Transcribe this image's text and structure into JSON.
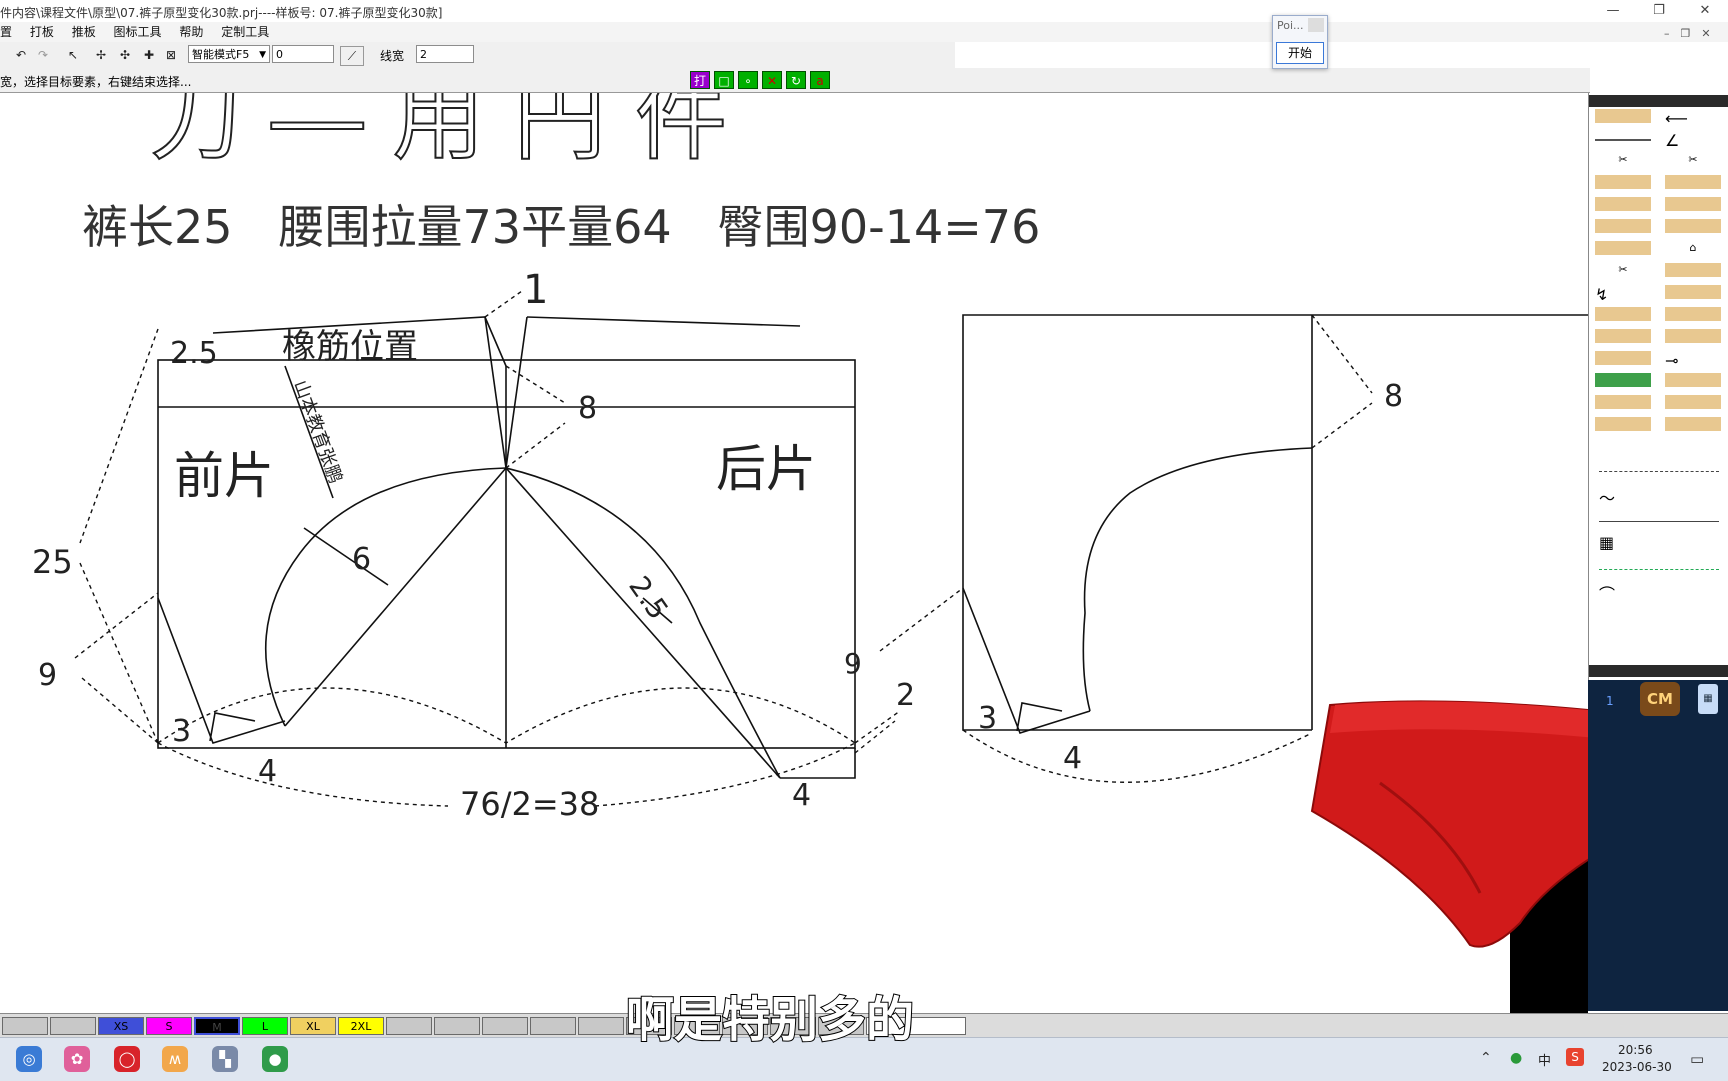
{
  "window": {
    "title": "件内容\\课程文件\\原型\\07.裤子原型变化30款.prj----样板号: 07.裤子原型变化30款]"
  },
  "menu": [
    "置",
    "打板",
    "推板",
    "图标工具",
    "帮助",
    "定制工具"
  ],
  "toolbar": {
    "mode_select": "智能模式F5",
    "mode_value": "0",
    "linewidth_label": "线宽",
    "linewidth_value": "2"
  },
  "status": {
    "hint": "宽，选择目标要素，右键结束选择...",
    "print_button": "打"
  },
  "poi_window": {
    "title": "Poi...",
    "start_button": "开始"
  },
  "drawing": {
    "heading": "刀 ― 用 円 件",
    "spec": "裤长25　腰围拉量73平量64　臀围90-14=76",
    "labels": {
      "dim_1": "1",
      "band": "2.5",
      "elastic": "橡筋位置",
      "watermark": "山本教育张鹏",
      "front": "前片",
      "back": "后片",
      "dim_8a": "8",
      "dim_8b": "8",
      "dim_25": "25",
      "dim_6": "6",
      "dim_2_5": "2.5",
      "dim_9a": "9",
      "dim_9b": "9",
      "dim_2": "2",
      "dim_3a": "3",
      "dim_3b": "3",
      "dim_4a": "4",
      "dim_4b": "4",
      "dim_4c": "4",
      "hip": "76/2=38"
    }
  },
  "right_panel": {
    "layer_number": "1",
    "unit_button": "CM"
  },
  "size_bar": {
    "sizes": [
      {
        "label": "XS",
        "color": "#3f4fd8"
      },
      {
        "label": "S",
        "color": "#ff00ff"
      },
      {
        "label": "M",
        "color": "#000000"
      },
      {
        "label": "L",
        "color": "#00ff00"
      },
      {
        "label": "XL",
        "color": "#f0d060"
      },
      {
        "label": "2XL",
        "color": "#ffff00"
      }
    ]
  },
  "taskbar": {
    "time": "20:56",
    "date": "2023-06-30",
    "ime": "中"
  },
  "subtitle": "啊是特别多的",
  "colors": {
    "garment": "#d11a1a",
    "panel_dark": "#0e2440"
  }
}
